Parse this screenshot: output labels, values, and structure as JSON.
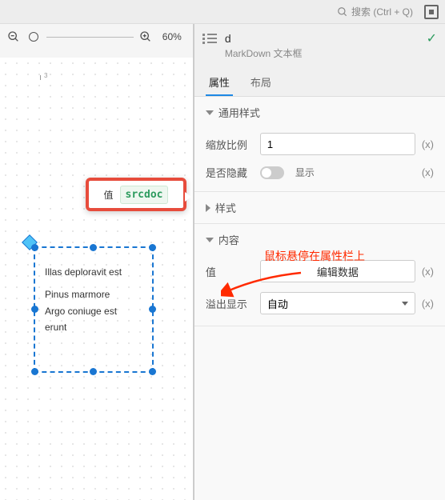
{
  "search": {
    "placeholder": "搜索 (Ctrl + Q)"
  },
  "zoom": {
    "pct": "60%"
  },
  "tooltip": {
    "label": "值",
    "value": "srcdoc"
  },
  "selection": {
    "lines": [
      "Illas deploravit est",
      "Pinus marmore",
      "Argo coniuge est",
      "erunt"
    ]
  },
  "ruler": {
    "mark": "3"
  },
  "component": {
    "name": "d",
    "subtitle": "MarkDown 文本框"
  },
  "tabs": {
    "properties": "属性",
    "layout": "布局"
  },
  "sections": {
    "general": {
      "title": "通用样式"
    },
    "style": {
      "title": "样式"
    },
    "content": {
      "title": "内容"
    }
  },
  "props": {
    "scale": {
      "label": "缩放比例",
      "value": "1"
    },
    "hidden": {
      "label": "是否隐藏",
      "display": "显示"
    },
    "value": {
      "label": "值",
      "button": "编辑数据"
    },
    "overflow": {
      "label": "溢出显示",
      "value": "自动"
    }
  },
  "xlink": "(x)",
  "annotation": "鼠标悬停在属性栏上"
}
